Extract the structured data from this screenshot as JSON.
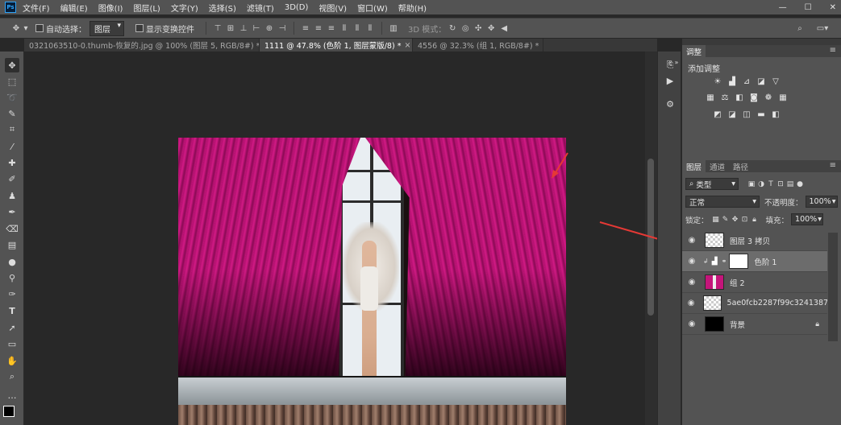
{
  "menubar": {
    "app_badge": "Ps",
    "items": [
      "文件(F)",
      "编辑(E)",
      "图像(I)",
      "图层(L)",
      "文字(Y)",
      "选择(S)",
      "滤镜(T)",
      "3D(D)",
      "视图(V)",
      "窗口(W)",
      "帮助(H)"
    ],
    "window_controls": {
      "minimize": "—",
      "restore": "☐",
      "close": "✕"
    }
  },
  "options": {
    "auto_select_label": "自动选择：",
    "auto_select_value": "图层",
    "show_transform_label": "显示变换控件",
    "mode_3d_label": "3D 模式："
  },
  "tabs": [
    {
      "label": "0321063510-0.thumb-恢复的.jpg @ 100% (图层 5, RGB/8#) *",
      "close": "×",
      "active": false
    },
    {
      "label": "1111 @ 47.8% (色阶 1, 图层蒙版/8) *",
      "close": "×",
      "active": true
    },
    {
      "label": "4556 @ 32.3% (组 1, RGB/8#) *",
      "close": "×",
      "active": false
    }
  ],
  "adjustments": {
    "panel_tab": "调整",
    "add_label": "添加调整"
  },
  "layers_panel": {
    "tabs": [
      "图层",
      "通道",
      "路径"
    ],
    "filter_kind": "类型",
    "blend_mode": "正常",
    "opacity_label": "不透明度：",
    "opacity_value": "100%",
    "lock_label": "锁定：",
    "fill_label": "填充：",
    "fill_value": "100%",
    "layers": [
      {
        "name": "图层 3 拷贝",
        "selected": false
      },
      {
        "name": "色阶 1",
        "selected": true
      },
      {
        "name": "组 2",
        "selected": false
      },
      {
        "name": "5ae0fcb2287f99c3241387...",
        "selected": false
      },
      {
        "name": "背景",
        "selected": false
      }
    ]
  },
  "colors": {
    "curtain": "#c4157a",
    "annotation_arrow": "#e53935",
    "ps_blue": "#2fa3f7"
  }
}
